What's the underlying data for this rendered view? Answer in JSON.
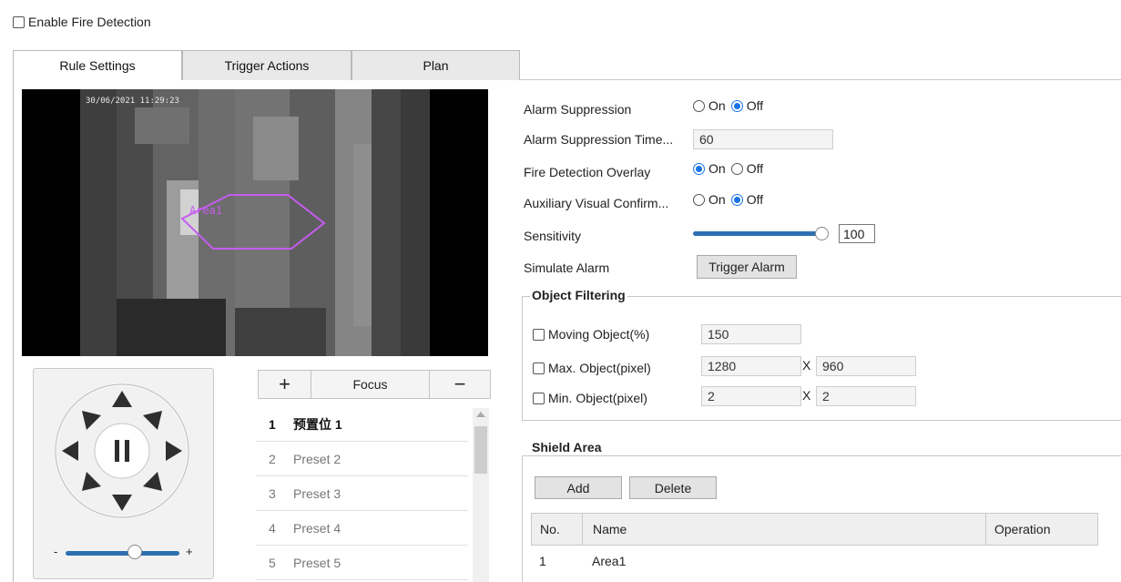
{
  "enable": {
    "label": "Enable Fire Detection"
  },
  "tabs": [
    {
      "label": "Rule Settings"
    },
    {
      "label": "Trigger Actions"
    },
    {
      "label": "Plan"
    }
  ],
  "video": {
    "timestamp": "30/06/2021 11:29:23",
    "area_label": "Area1"
  },
  "preset_bar": {
    "plus": "+",
    "focus": "Focus",
    "minus": "−"
  },
  "presets": [
    {
      "num": "1",
      "name": "预置位 1"
    },
    {
      "num": "2",
      "name": "Preset 2"
    },
    {
      "num": "3",
      "name": "Preset 3"
    },
    {
      "num": "4",
      "name": "Preset 4"
    },
    {
      "num": "5",
      "name": "Preset 5"
    }
  ],
  "ptz": {
    "minus": "-",
    "plus": "+"
  },
  "form": {
    "alarm_suppression": {
      "label": "Alarm Suppression",
      "on": "On",
      "off": "Off"
    },
    "suppression_time": {
      "label": "Alarm Suppression Time...",
      "value": "60"
    },
    "overlay": {
      "label": "Fire Detection Overlay",
      "on": "On",
      "off": "Off"
    },
    "aux_visual": {
      "label": "Auxiliary Visual Confirm...",
      "on": "On",
      "off": "Off"
    },
    "sensitivity": {
      "label": "Sensitivity",
      "value": "100"
    },
    "simulate": {
      "label": "Simulate Alarm",
      "button": "Trigger Alarm"
    }
  },
  "object_filtering": {
    "title": "Object Filtering",
    "moving": {
      "label": "Moving Object(%)",
      "value": "150"
    },
    "max": {
      "label": "Max. Object(pixel)",
      "w": "1280",
      "x": "X",
      "h": "960"
    },
    "min": {
      "label": "Min. Object(pixel)",
      "w": "2",
      "x": "X",
      "h": "2"
    }
  },
  "shield_area": {
    "title": "Shield Area",
    "add": "Add",
    "delete": "Delete",
    "columns": {
      "no": "No.",
      "name": "Name",
      "operation": "Operation"
    },
    "rows": [
      {
        "no": "1",
        "name": "Area1"
      }
    ]
  },
  "colors": {
    "accent": "#1a73e8",
    "slider": "#2d6fb2",
    "area_outline": "#c65cf0"
  }
}
